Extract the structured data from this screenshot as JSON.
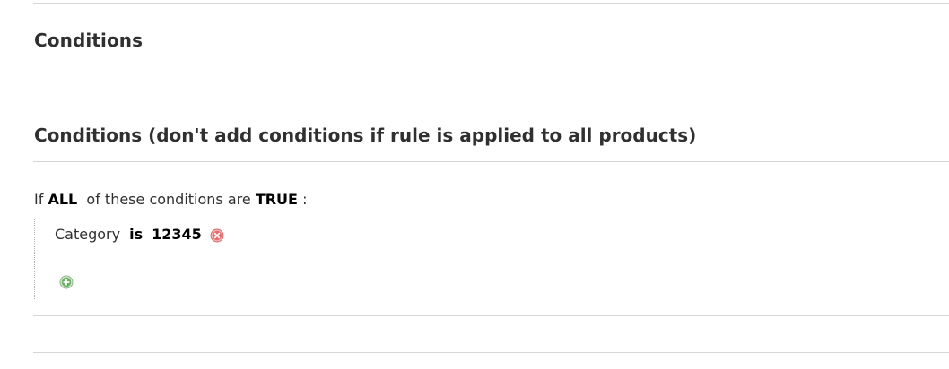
{
  "section": {
    "title": "Conditions"
  },
  "fieldset": {
    "title": "Conditions (don't add conditions if rule is applied to all products)"
  },
  "rule": {
    "prefix": "If",
    "aggregator": "ALL",
    "middle": "of these conditions are",
    "value": "TRUE",
    "suffix": ":"
  },
  "conditions": [
    {
      "attribute": "Category",
      "operator": "is",
      "value": "12345",
      "remove_icon": "remove-circle-icon"
    }
  ],
  "add_icon": "add-circle-icon",
  "colors": {
    "remove": "#e05a5a",
    "add": "#5aa05a",
    "divider": "#d6d6d6"
  }
}
